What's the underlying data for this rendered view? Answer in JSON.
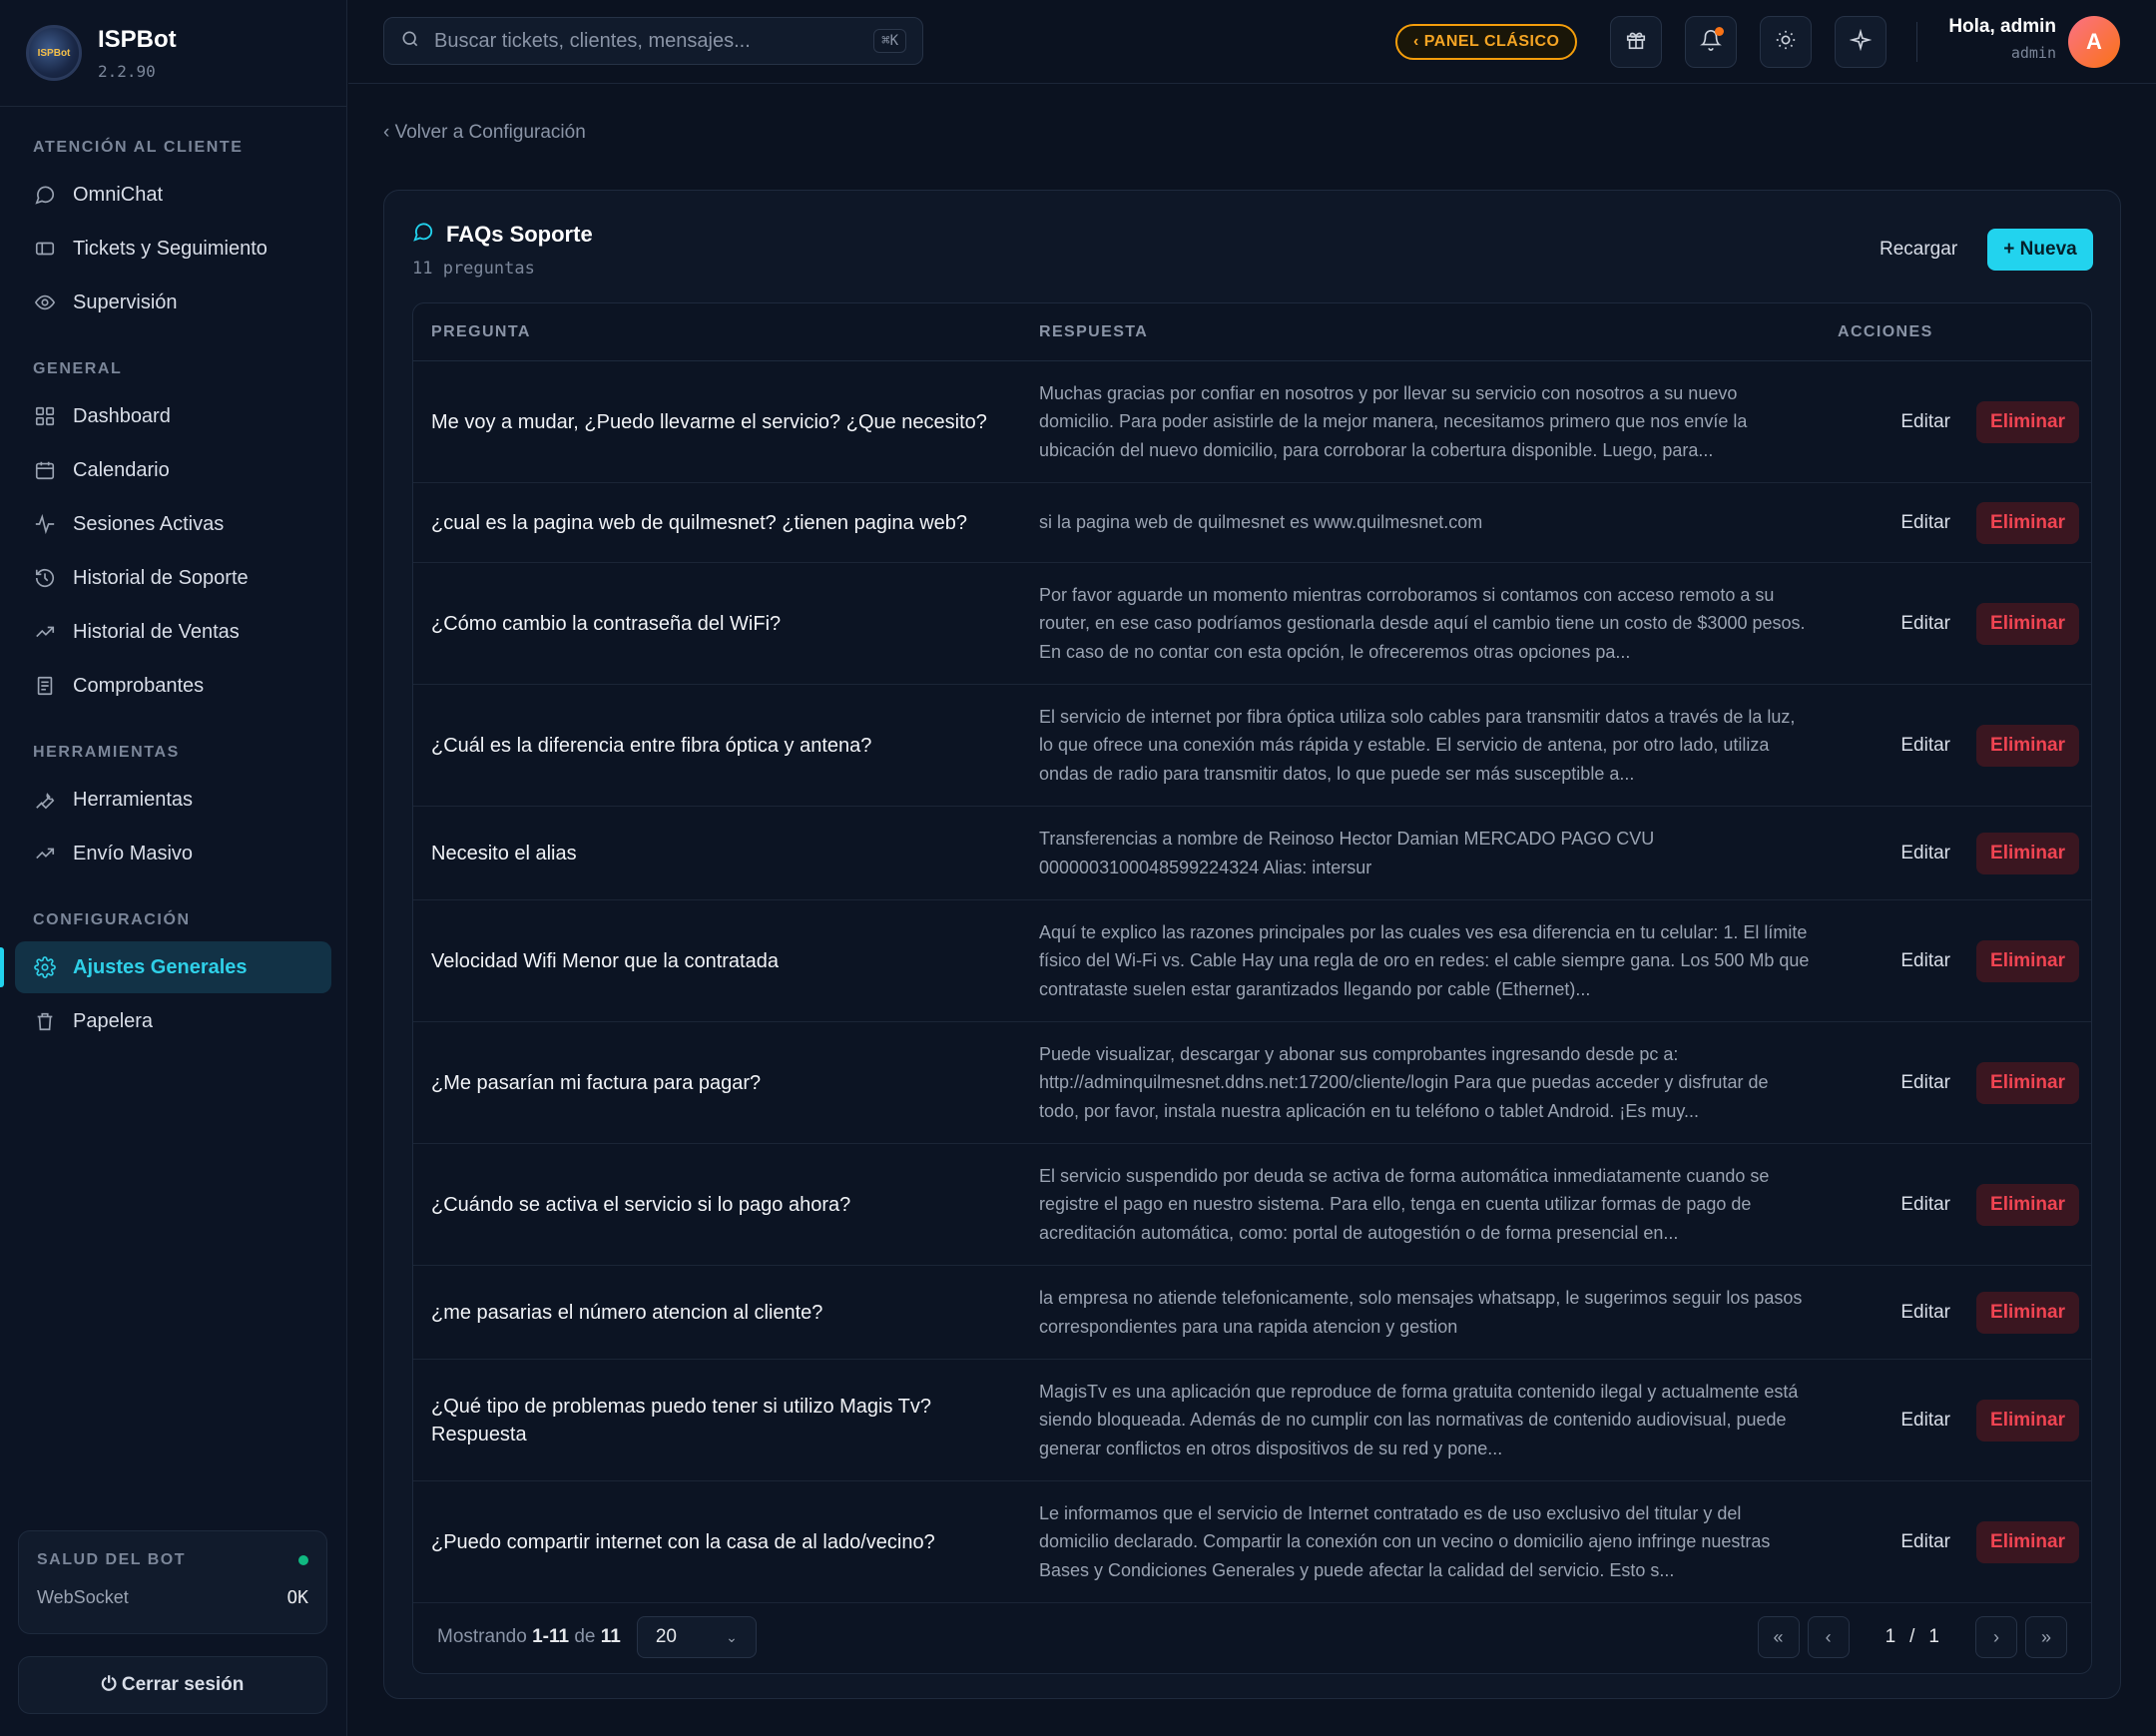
{
  "brand": {
    "name": "ISPBot",
    "version": "2.2.90",
    "logo_text": "ISPBot"
  },
  "sidebar": {
    "sections": [
      {
        "title": "ATENCIÓN AL CLIENTE",
        "items": [
          {
            "label": "OmniChat",
            "icon": "chat-icon"
          },
          {
            "label": "Tickets y Seguimiento",
            "icon": "ticket-icon"
          },
          {
            "label": "Supervisión",
            "icon": "eye-icon"
          }
        ]
      },
      {
        "title": "GENERAL",
        "items": [
          {
            "label": "Dashboard",
            "icon": "grid-icon"
          },
          {
            "label": "Calendario",
            "icon": "calendar-icon"
          },
          {
            "label": "Sesiones Activas",
            "icon": "activity-icon"
          },
          {
            "label": "Historial de Soporte",
            "icon": "history-icon"
          },
          {
            "label": "Historial de Ventas",
            "icon": "trend-icon"
          },
          {
            "label": "Comprobantes",
            "icon": "receipt-icon"
          }
        ]
      },
      {
        "title": "HERRAMIENTAS",
        "items": [
          {
            "label": "Herramientas",
            "icon": "wrench-icon"
          },
          {
            "label": "Envío Masivo",
            "icon": "trend-icon"
          }
        ]
      },
      {
        "title": "CONFIGURACIÓN",
        "items": [
          {
            "label": "Ajustes Generales",
            "icon": "gear-icon",
            "active": true
          },
          {
            "label": "Papelera",
            "icon": "trash-icon"
          }
        ]
      }
    ],
    "health": {
      "title": "SALUD DEL BOT",
      "label": "WebSocket",
      "status": "OK",
      "status_color": "#10b981"
    },
    "logout_label": "⏻ Cerrar sesión"
  },
  "topbar": {
    "search_placeholder": "Buscar tickets, clientes, mensajes...",
    "shortcut": "⌘K",
    "panel_label": "‹ PANEL CLÁSICO",
    "greeting": "Hola, admin",
    "role": "admin",
    "avatar_initial": "A"
  },
  "main": {
    "back_label": "‹ Volver a Configuración",
    "title": "FAQs Soporte",
    "subtitle": "11 preguntas",
    "reload_label": "Recargar",
    "new_label": "+ Nueva",
    "columns": {
      "question": "PREGUNTA",
      "answer": "RESPUESTA",
      "actions": "ACCIONES"
    },
    "edit_label": "Editar",
    "delete_label": "Eliminar",
    "rows": [
      {
        "q": "Me voy a mudar, ¿Puedo llevarme el servicio? ¿Que necesito?",
        "a": "Muchas gracias por confiar en nosotros y por llevar su servicio con nosotros a su nuevo domicilio. Para poder asistirle de la mejor manera, necesitamos primero que nos envíe la ubicación del nuevo domicilio, para corroborar la cobertura disponible. Luego, para..."
      },
      {
        "q": "¿cual es la pagina web de quilmesnet? ¿tienen pagina web?",
        "a": "si la pagina web de quilmesnet es www.quilmesnet.com"
      },
      {
        "q": "¿Cómo cambio la contraseña del WiFi?",
        "a": "Por favor aguarde un momento mientras corroboramos si contamos con acceso remoto a su router, en ese caso podríamos gestionarla desde aquí el cambio tiene un costo de $3000 pesos. En caso de no contar con esta opción, le ofreceremos otras opciones pa..."
      },
      {
        "q": "¿Cuál es la diferencia entre fibra óptica y antena?",
        "a": "El servicio de internet por fibra óptica utiliza solo cables para transmitir datos a través de la luz, lo que ofrece una conexión más rápida y estable. El servicio de antena, por otro lado, utiliza ondas de radio para transmitir datos, lo que puede ser más susceptible a..."
      },
      {
        "q": "Necesito el alias",
        "a": "Transferencias a nombre de Reinoso Hector Damian MERCADO PAGO CVU 0000003100048599224324 Alias: intersur"
      },
      {
        "q": "Velocidad Wifi Menor que la contratada",
        "a": "Aquí te explico las razones principales por las cuales ves esa diferencia en tu celular: 1. El límite físico del Wi-Fi vs. Cable Hay una regla de oro en redes: el cable siempre gana. Los 500 Mb que contrataste suelen estar garantizados llegando por cable (Ethernet)..."
      },
      {
        "q": "¿Me pasarían mi factura para pagar?",
        "a": "Puede visualizar, descargar y abonar sus comprobantes ingresando desde pc a: http://adminquilmesnet.ddns.net:17200/cliente/login Para que puedas acceder y disfrutar de todo, por favor, instala nuestra aplicación en tu teléfono o tablet Android. ¡Es muy..."
      },
      {
        "q": "¿Cuándo se activa el servicio si lo pago ahora?",
        "a": "El servicio suspendido por deuda se activa de forma automática inmediatamente cuando se registre el pago en nuestro sistema. Para ello, tenga en cuenta utilizar formas de pago de acreditación automática, como: portal de autogestión o de forma presencial en..."
      },
      {
        "q": "¿me pasarias el número atencion al cliente?",
        "a": "la empresa no atiende telefonicamente, solo mensajes whatsapp, le sugerimos seguir los pasos correspondientes para una rapida atencion y gestion"
      },
      {
        "q": "¿Qué tipo de problemas puedo tener si utilizo Magis Tv? Respuesta",
        "a": "MagisTv es una aplicación que reproduce de forma gratuita contenido ilegal y actualmente está siendo bloqueada. Además de no cumplir con las normativas de contenido audiovisual, puede generar conflictos en otros dispositivos de su red y pone..."
      },
      {
        "q": "¿Puedo compartir internet con la casa de al lado/vecino?",
        "a": "Le informamos que el servicio de Internet contratado es de uso exclusivo del titular y del domicilio declarado. Compartir la conexión con un vecino o domicilio ajeno infringe nuestras Bases y Condiciones Generales y puede afectar la calidad del servicio. Esto s..."
      }
    ],
    "footer": {
      "showing_prefix": "Mostrando",
      "range": "1-11",
      "of": "de",
      "total": "11",
      "per_page": "20",
      "page": "1",
      "page_sep": "/",
      "pages": "1"
    }
  }
}
